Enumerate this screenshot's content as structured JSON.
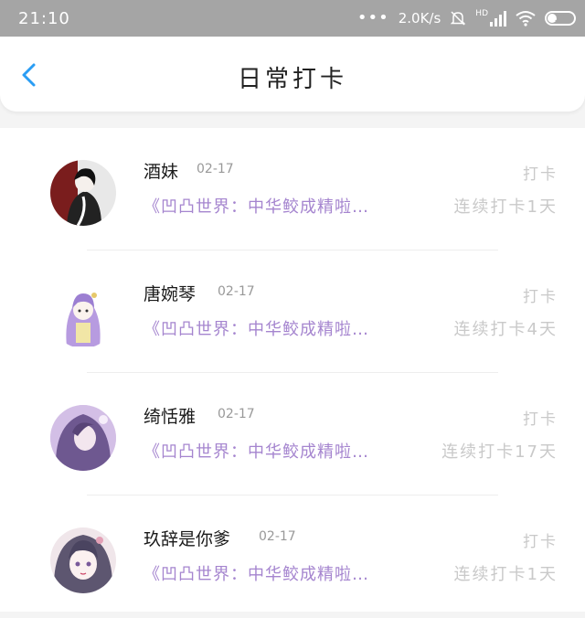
{
  "status_bar": {
    "time": "21:10",
    "speed": "2.0K/s",
    "hd_label": "HD",
    "battery": "32"
  },
  "header": {
    "title": "日常打卡"
  },
  "items": [
    {
      "name": "酒妹",
      "date": "02-17",
      "action": "打卡",
      "book": "《凹凸世界：中华鲛成精啦…",
      "streak": "连续打卡1天"
    },
    {
      "name": "唐婉琴",
      "date": "02-17",
      "action": "打卡",
      "book": "《凹凸世界：中华鲛成精啦…",
      "streak": "连续打卡4天"
    },
    {
      "name": "绮恬雅",
      "date": "02-17",
      "action": "打卡",
      "book": "《凹凸世界：中华鲛成精啦…",
      "streak": "连续打卡17天"
    },
    {
      "name": "玖辞是你爹",
      "date": "02-17",
      "action": "打卡",
      "book": "《凹凸世界：中华鲛成精啦…",
      "streak": "连续打卡1天"
    }
  ],
  "colors": {
    "accent": "#2a9df4",
    "book_text": "#a585cf",
    "muted": "#c9c9c9"
  }
}
